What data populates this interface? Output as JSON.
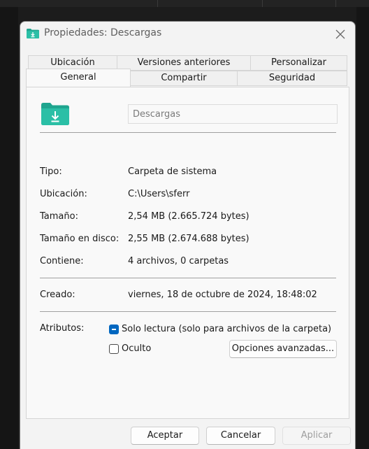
{
  "window": {
    "title": "Propiedades: Descargas"
  },
  "tabs_row1": [
    "Ubicación",
    "Versiones anteriores",
    "Personalizar"
  ],
  "tabs_row2": [
    "General",
    "Compartir",
    "Seguridad"
  ],
  "general": {
    "folder_name": "Descargas",
    "info": [
      {
        "label": "Tipo:",
        "value": "Carpeta de sistema"
      },
      {
        "label": "Ubicación:",
        "value": "C:\\Users\\sferr"
      },
      {
        "label": "Tamaño:",
        "value": "2,54 MB (2.665.724 bytes)"
      },
      {
        "label": "Tamaño en disco:",
        "value": "2,55 MB (2.674.688 bytes)"
      },
      {
        "label": "Contiene:",
        "value": "4 archivos, 0 carpetas"
      }
    ],
    "created": {
      "label": "Creado:",
      "value": "viernes, 18 de octubre de 2024, 18:48:02"
    },
    "attributes": {
      "label": "Atributos:",
      "readonly_label": "Solo lectura (solo para archivos de la carpeta)",
      "hidden_label": "Oculto",
      "advanced_button": "Opciones avanzadas..."
    }
  },
  "footer": {
    "ok": "Aceptar",
    "cancel": "Cancelar",
    "apply": "Aplicar"
  },
  "colors": {
    "folder": "#1fa58f",
    "accent": "#0067c0"
  },
  "icons": {
    "title": "folder-download-icon",
    "large": "folder-download-icon",
    "close": "close-icon"
  }
}
